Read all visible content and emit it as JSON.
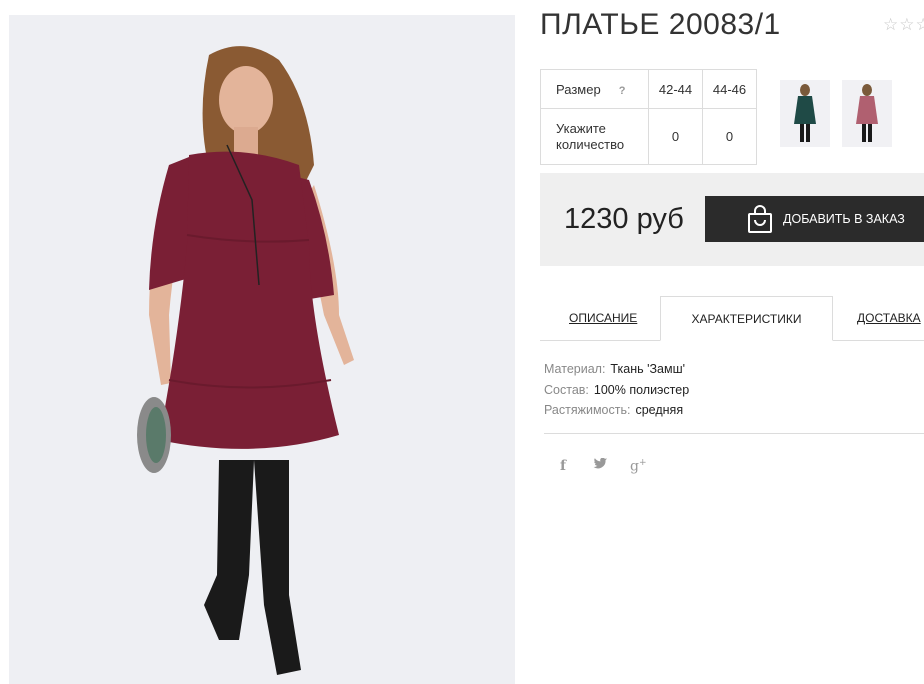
{
  "product": {
    "title": "ПЛАТЬЕ 20083/1",
    "rating_stars": "☆☆☆"
  },
  "sizes": {
    "label": "Размер",
    "help": "?",
    "options": [
      "42-44",
      "44-46"
    ],
    "quantity_label": "Укажите количество",
    "quantities": [
      "0",
      "0"
    ]
  },
  "thumbnails": [
    {
      "color": "#1f4a46"
    },
    {
      "color": "#8a3048"
    }
  ],
  "price": {
    "value": "1230 руб",
    "button_label": "ДОБАВИТЬ В ЗАКАЗ"
  },
  "tabs": [
    {
      "label": "ОПИСАНИЕ"
    },
    {
      "label": "ХАРАКТЕРИСТИКИ"
    },
    {
      "label": "ДОСТАВКА"
    }
  ],
  "specs": [
    {
      "key": "Материал:",
      "value": "Ткань 'Замш'"
    },
    {
      "key": "Состав:",
      "value": "100% полиэстер"
    },
    {
      "key": "Растяжимость:",
      "value": "средняя"
    }
  ],
  "social": {
    "facebook": "f",
    "twitter": "🐦",
    "google": "g+"
  },
  "colors": {
    "dress": "#7a1f35",
    "boots": "#1a1a1a",
    "button_bg": "#2b2b2b",
    "price_bg": "#efefef"
  }
}
